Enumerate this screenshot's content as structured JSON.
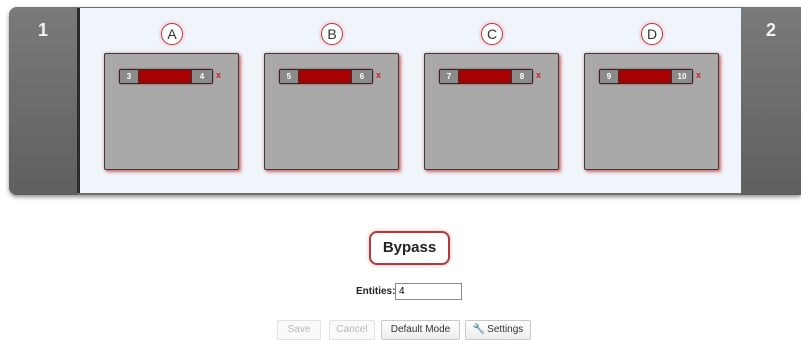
{
  "frame": {
    "left_number": "1",
    "right_number": "2",
    "slots": [
      {
        "letter": "A",
        "bar_start": "3",
        "bar_end": "4",
        "close": "x"
      },
      {
        "letter": "B",
        "bar_start": "5",
        "bar_end": "6",
        "close": "x"
      },
      {
        "letter": "C",
        "bar_start": "7",
        "bar_end": "8",
        "close": "x"
      },
      {
        "letter": "D",
        "bar_start": "9",
        "bar_end": "10",
        "close": "x"
      }
    ]
  },
  "mode": {
    "label": "Bypass"
  },
  "entities": {
    "label": "Entities:",
    "value": "4"
  },
  "buttons": {
    "save": "Save",
    "cancel": "Cancel",
    "default_mode": "Default Mode",
    "settings": "Settings",
    "settings_icon": "wrench-icon"
  },
  "colors": {
    "bar_fill": "#a80000",
    "accent_red": "#c23434",
    "stage_background": "#f0f4fb",
    "frame_gray": "#6f6f6f"
  }
}
